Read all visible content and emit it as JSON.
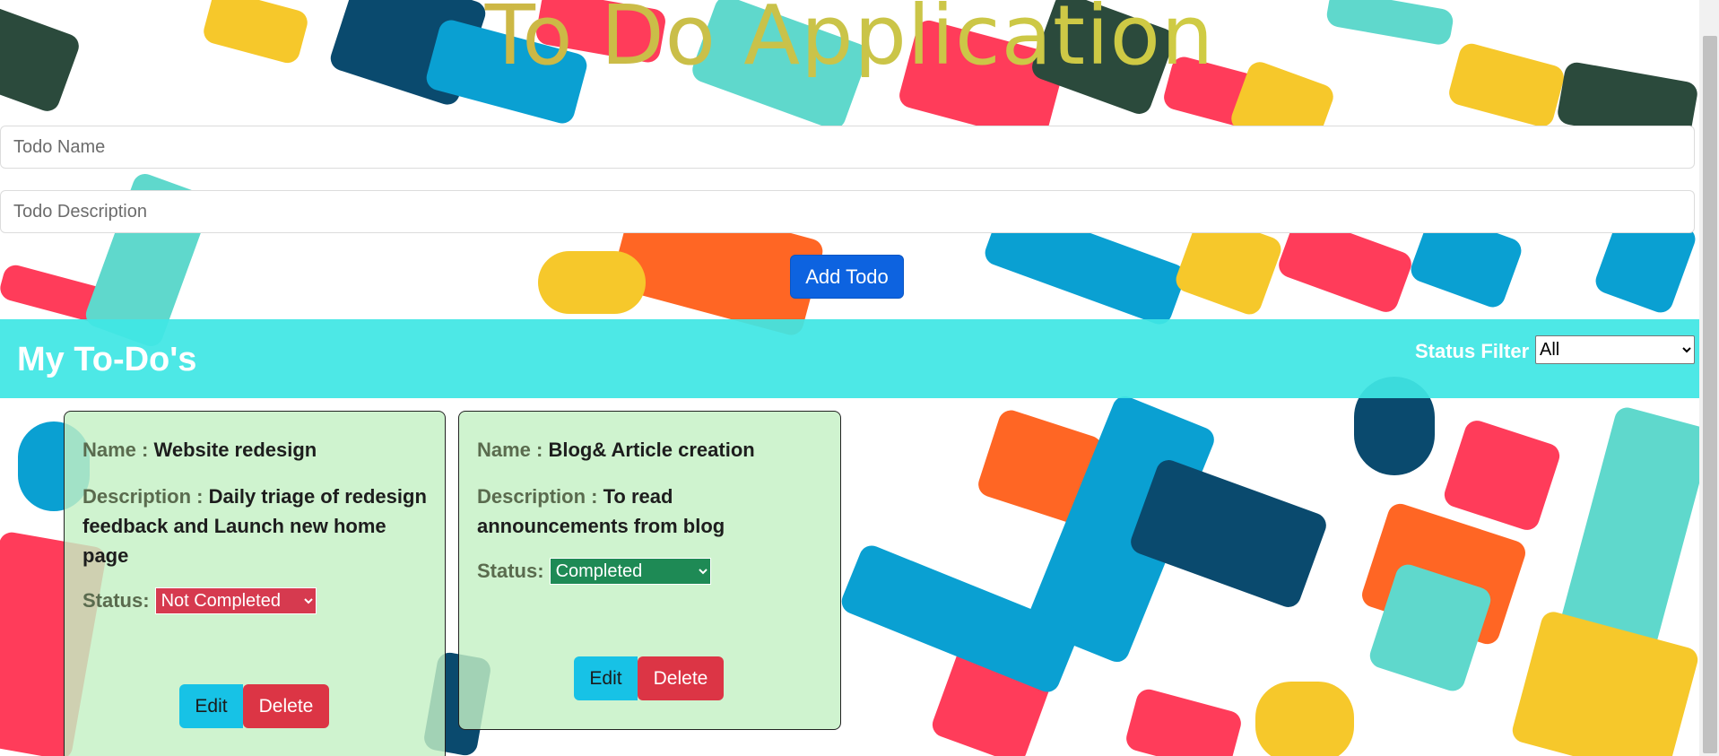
{
  "app": {
    "title": "To Do Application"
  },
  "form": {
    "name_placeholder": "Todo Name",
    "description_placeholder": "Todo Description",
    "add_label": "Add Todo"
  },
  "list_header": {
    "title": "My To-Do's",
    "filter_label": "Status Filter :",
    "filter_value": "All"
  },
  "labels": {
    "name": "Name :",
    "description": "Description :",
    "status": "Status:",
    "edit": "Edit",
    "delete": "Delete"
  },
  "todos": [
    {
      "name": "Website redesign",
      "description": "Daily triage of redesign feedback and Launch new home page",
      "status": "Not Completed",
      "status_color": "#d63a4f"
    },
    {
      "name": "Blog& Article creation",
      "description": "To read announcements from blog",
      "status": "Completed",
      "status_color": "#1e8a55"
    }
  ],
  "colors": {
    "accent": "#0d63e0",
    "banner": "#40e6e4",
    "edit_button": "#17c2e6",
    "delete_button": "#dc3545"
  }
}
